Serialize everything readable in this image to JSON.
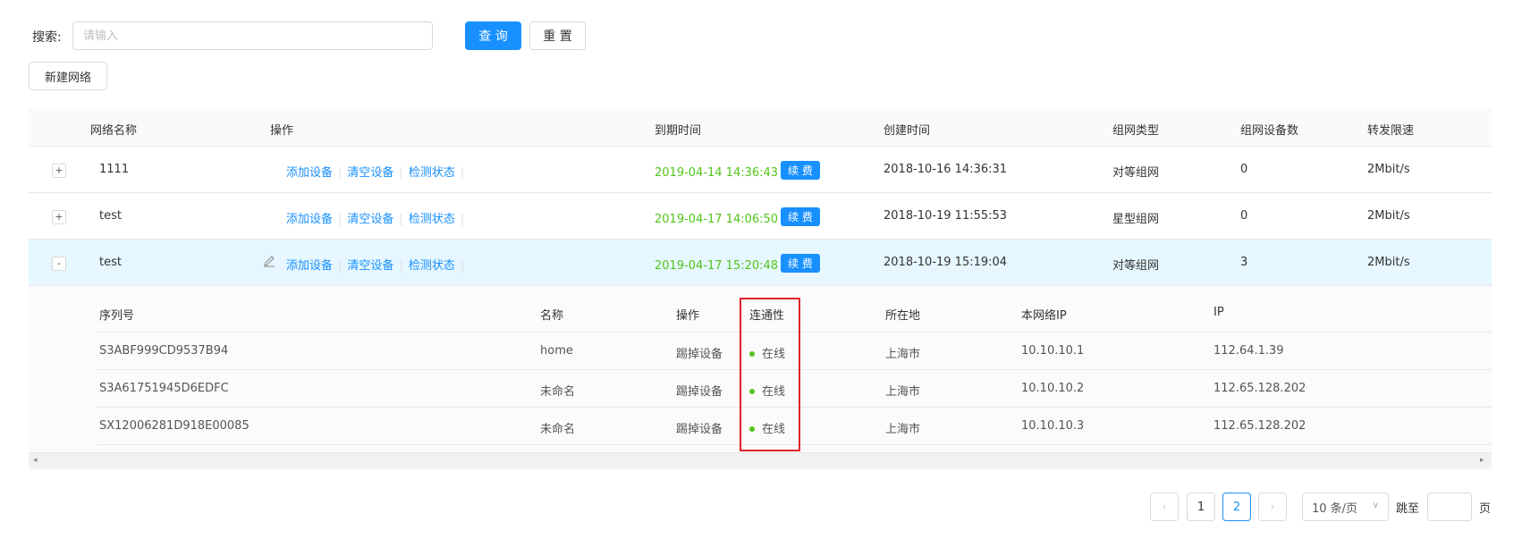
{
  "search": {
    "label": "搜索:",
    "placeholder": "请输入",
    "value": ""
  },
  "buttons": {
    "query": "查 询",
    "reset": "重 置",
    "new_network": "新建网络"
  },
  "table": {
    "headers": [
      "网络名称",
      "操作",
      "到期时间",
      "创建时间",
      "组网类型",
      "组网设备数",
      "转发限速"
    ],
    "actions": [
      "添加设备",
      "清空设备",
      "检测状态"
    ],
    "renew_label": "续 费",
    "rows": [
      {
        "expand": "+",
        "name": "1111",
        "expire": "2019-04-14 14:36:43",
        "created": "2018-10-16 14:36:31",
        "type": "对等组网",
        "devices": "0",
        "speed": "2Mbit/s"
      },
      {
        "expand": "+",
        "name": "test",
        "expire": "2019-04-17 14:06:50",
        "created": "2018-10-19 11:55:53",
        "type": "星型组网",
        "devices": "0",
        "speed": "2Mbit/s"
      },
      {
        "expand": "-",
        "name": "test",
        "expire": "2019-04-17 15:20:48",
        "created": "2018-10-19 15:19:04",
        "type": "对等组网",
        "devices": "3",
        "speed": "2Mbit/s"
      }
    ]
  },
  "devices": {
    "headers": [
      "序列号",
      "名称",
      "操作",
      "连通性",
      "所在地",
      "本网络IP",
      "IP"
    ],
    "action_label": "踢掉设备",
    "rows": [
      {
        "serial": "S3ABF999CD9537B94",
        "name": "home",
        "status": "在线",
        "location": "上海市",
        "net_ip": "10.10.10.1",
        "ip": "112.64.1.39"
      },
      {
        "serial": "S3A61751945D6EDFC",
        "name": "未命名",
        "status": "在线",
        "location": "上海市",
        "net_ip": "10.10.10.2",
        "ip": "112.65.128.202"
      },
      {
        "serial": "SX12006281D918E00085",
        "name": "未命名",
        "status": "在线",
        "location": "上海市",
        "net_ip": "10.10.10.3",
        "ip": "112.65.128.202"
      }
    ]
  },
  "pagination": {
    "prev": "‹",
    "next": "›",
    "pages": [
      "1",
      "2"
    ],
    "current": "2",
    "page_size": "10 条/页",
    "jump_label": "跳至",
    "page_suffix": "页"
  },
  "colors": {
    "primary": "#1890ff",
    "online": "#52c41a",
    "highlight": "#e0242a",
    "active_row": "#e6f7ff"
  }
}
